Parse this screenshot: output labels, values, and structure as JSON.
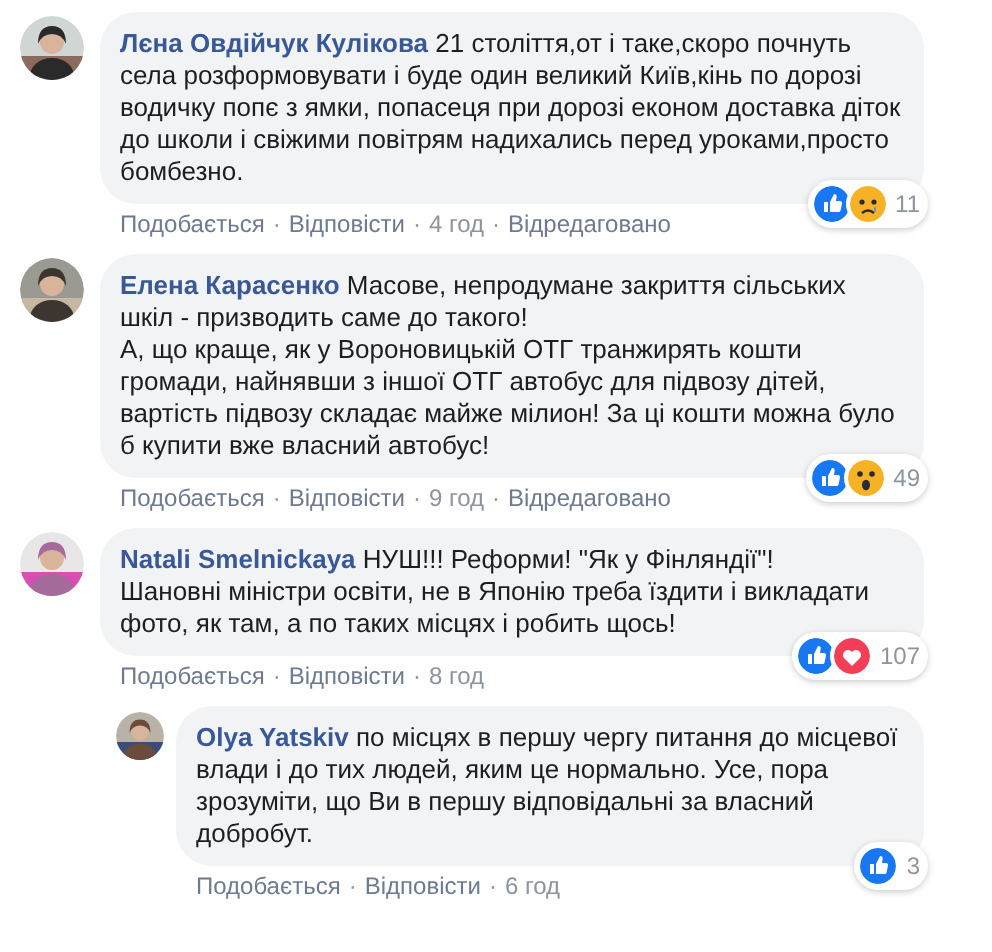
{
  "separator": "·",
  "comments": [
    {
      "author": "Лєна Овдійчук Кулікова",
      "text": "21 століття,от і таке,скоро почнуть села розформовувати і буде один великий Київ,кінь по дорозі водичку попє з ямки, попасеця при дорозі економ доставка діток до школи і свіжими повітрям надихались перед уроками,просто бомбезно.",
      "reply": false,
      "reactions": [
        {
          "kind": "like"
        },
        {
          "kind": "sad"
        }
      ],
      "count": "11",
      "actions": [
        "Подобається",
        "Відповісти",
        "4 год",
        "Відредаговано"
      ]
    },
    {
      "author": "Елена Карасенко",
      "text": "Масове, непродумане закриття сільських шкіл - призводить саме до такого!\nА, що краще, як у Вороновицькій ОТГ транжирять кошти громади, найнявши з іншої ОТГ автобус для підвозу дітей, вартість підвозу складає майже мілион! За ці кошти можна було б купити вже власний автобус!",
      "reply": false,
      "reactions": [
        {
          "kind": "like"
        },
        {
          "kind": "wow"
        }
      ],
      "count": "49",
      "actions": [
        "Подобається",
        "Відповісти",
        "9 год",
        "Відредаговано"
      ]
    },
    {
      "author": "Natali Smelnickaya",
      "text": "НУШ!!! Реформи! \"Як у Фінляндії\"!\nШановні міністри освіти, не в Японію треба їздити і викладати фото, як там, а по таких місцях і робить щось!",
      "reply": false,
      "reactions": [
        {
          "kind": "like"
        },
        {
          "kind": "love"
        }
      ],
      "count": "107",
      "actions": [
        "Подобається",
        "Відповісти",
        "8 год"
      ]
    },
    {
      "author": "Olya Yatskiv",
      "text": "по місцях в першу чергу питання до місцевої влади і до тих людей, яким це нормально. Усе, пора зрозуміти, що Ви в першу відповідальні за власний добробут.",
      "reply": true,
      "reactions": [
        {
          "kind": "like"
        }
      ],
      "count": "3",
      "actions": [
        "Подобається",
        "Відповісти",
        "6 год"
      ]
    }
  ]
}
